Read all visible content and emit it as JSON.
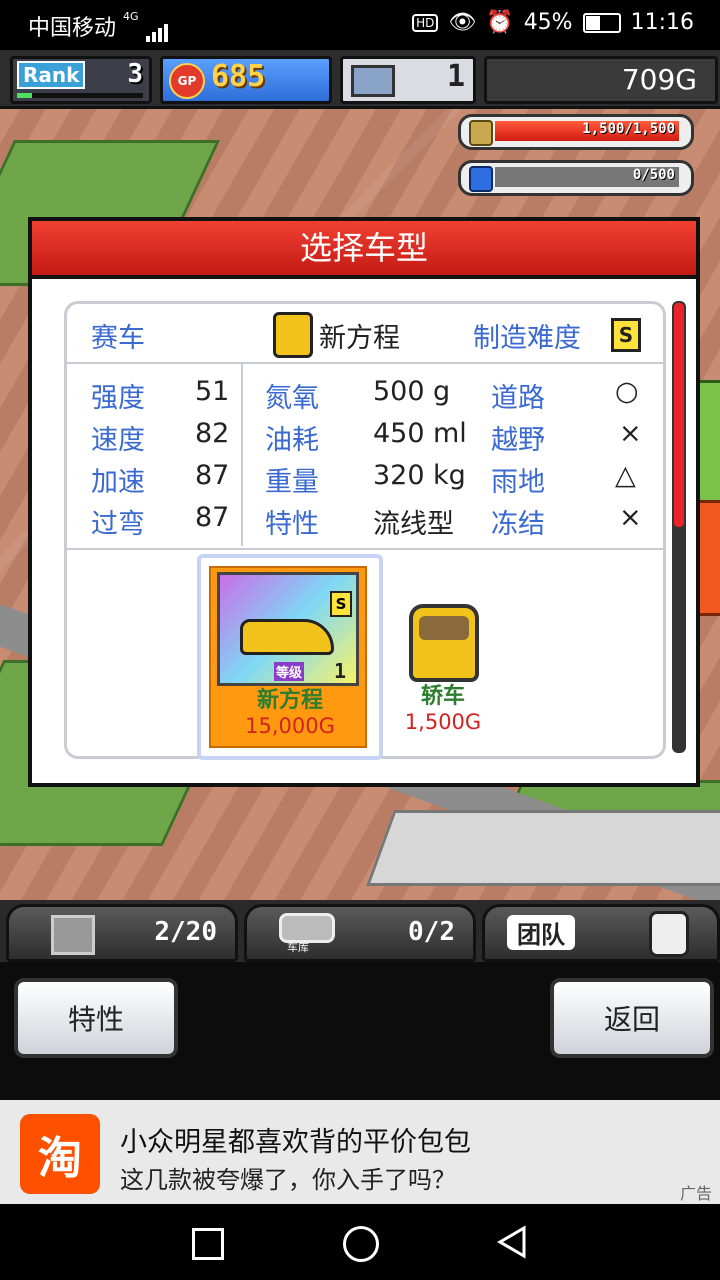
{
  "status_bar": {
    "carrier": "中国移动",
    "network": "4G",
    "battery": "45%",
    "time": "11:16"
  },
  "hud": {
    "rank_label": "Rank",
    "rank_value": "3",
    "rank_progress": 0.12,
    "gp_label": "GP",
    "gp_value": "685",
    "pc_value": "1",
    "money": "709G",
    "resource1": "1,500/1,500",
    "resource1_fill": 1.0,
    "resource2": "0/500",
    "resource2_fill": 0.0
  },
  "dialog": {
    "title": "选择车型",
    "category_label": "赛车",
    "car_name": "新方程",
    "difficulty_label": "制造难度",
    "difficulty_value": "S",
    "stats": [
      {
        "label": "强度",
        "value": "51"
      },
      {
        "label": "速度",
        "value": "82"
      },
      {
        "label": "加速",
        "value": "87"
      },
      {
        "label": "过弯",
        "value": "87"
      }
    ],
    "specs": [
      {
        "label": "氮氧",
        "value": "500",
        "unit": "g"
      },
      {
        "label": "油耗",
        "value": "450",
        "unit": "ml"
      },
      {
        "label": "重量",
        "value": "320",
        "unit": "kg"
      },
      {
        "label": "特性",
        "value": "流线型",
        "unit": ""
      }
    ],
    "terrain": [
      {
        "label": "道路",
        "value": "○"
      },
      {
        "label": "越野",
        "value": "×"
      },
      {
        "label": "雨地",
        "value": "△"
      },
      {
        "label": "冻结",
        "value": "×"
      }
    ],
    "cars": [
      {
        "name": "新方程",
        "price": "15,000G",
        "badge": "S",
        "level_label": "等级",
        "level": "1"
      },
      {
        "name": "轿车",
        "price": "1,500G"
      }
    ]
  },
  "bottom_hud": {
    "tab1_count": "2/20",
    "tab2_label": "车库",
    "tab2_count": "0/2",
    "tab3_label": "团队"
  },
  "buttons": {
    "traits": "特性",
    "back": "返回"
  },
  "ad": {
    "logo": "淘",
    "line1": "小众明星都喜欢背的平价包包",
    "line2": "这几款被夸爆了，你入手了吗？",
    "tag": "广告"
  }
}
